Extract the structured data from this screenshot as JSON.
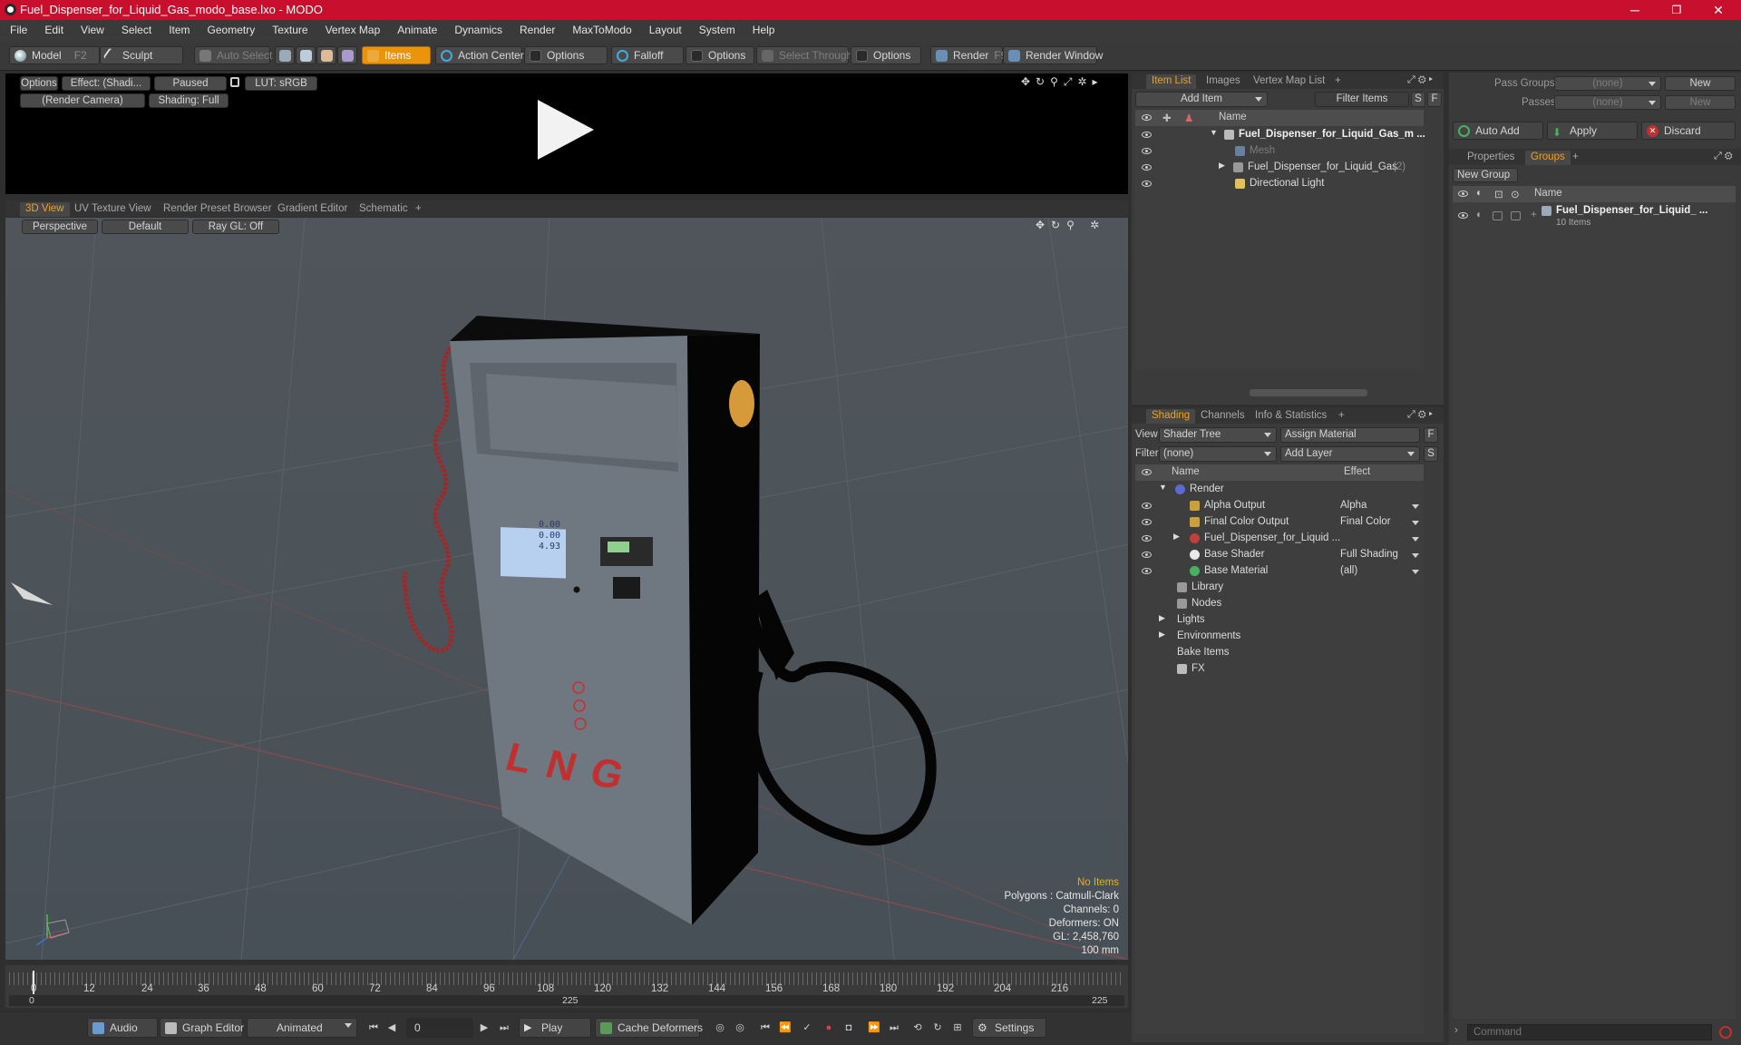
{
  "window": {
    "title": "Fuel_Dispenser_for_Liquid_Gas_modo_base.lxo - MODO",
    "minimize": "─",
    "maximize": "❐",
    "close": "✕"
  },
  "menu": [
    "File",
    "Edit",
    "View",
    "Select",
    "Item",
    "Geometry",
    "Texture",
    "Vertex Map",
    "Animate",
    "Dynamics",
    "Render",
    "MaxToModo",
    "Layout",
    "System",
    "Help"
  ],
  "toolbar": {
    "model": "Model",
    "model_key": "F2",
    "sculpt": "Sculpt",
    "auto_select": "Auto Select",
    "items": "Items",
    "action_center": "Action Center",
    "options1": "Options",
    "falloff": "Falloff",
    "options2": "Options",
    "select_through": "Select Through",
    "options3": "Options",
    "render": "Render",
    "render_key": "F9",
    "render_window": "Render Window"
  },
  "preview": {
    "options": "Options",
    "effect": "Effect: (Shadi...",
    "paused": "Paused",
    "lut": "LUT: sRGB",
    "camera": "(Render Camera)",
    "shading": "Shading: Full"
  },
  "view_tabs": [
    "3D View",
    "UV Texture View",
    "Render Preset Browser",
    "Gradient Editor",
    "Schematic",
    "+"
  ],
  "viewport": {
    "perspective": "Perspective",
    "default": "Default",
    "raygl": "Ray GL: Off",
    "lng_text": "LNG",
    "display_a": "0.00",
    "display_b": "0.00",
    "display_c": "4.93",
    "hud": {
      "no_items": "No Items",
      "polygons": "Polygons : Catmull-Clark",
      "channels": "Channels: 0",
      "deformers": "Deformers: ON",
      "gl": "GL: 2,458,760",
      "unit": "100 mm"
    }
  },
  "timeline": {
    "ticks": [
      "0",
      "12",
      "24",
      "36",
      "48",
      "60",
      "72",
      "84",
      "96",
      "108",
      "120",
      "132",
      "144",
      "156",
      "168",
      "180",
      "192",
      "204",
      "216"
    ],
    "start": "0",
    "mid": "225",
    "end": "225"
  },
  "bottombar": {
    "audio": "Audio",
    "graph_editor": "Graph Editor",
    "animated": "Animated",
    "frame": "0",
    "play": "Play",
    "cache_deformers": "Cache Deformers",
    "settings": "Settings",
    "command_placeholder": "Command"
  },
  "itemlist": {
    "tabs": [
      "Item List",
      "Images",
      "Vertex Map List",
      "+"
    ],
    "add_item": "Add Item",
    "filter_items": "Filter Items",
    "s": "S",
    "f": "F",
    "col_name": "Name",
    "rows": [
      {
        "label": "Fuel_Dispenser_for_Liquid_Gas_m ..."
      },
      {
        "label": "Mesh"
      },
      {
        "label": "Fuel_Dispenser_for_Liquid_Gas",
        "count": "(2)"
      },
      {
        "label": "Directional Light"
      }
    ]
  },
  "shading": {
    "tabs": [
      "Shading",
      "Channels",
      "Info & Statistics",
      "+"
    ],
    "view_label": "View",
    "view_value": "Shader Tree",
    "assign_material": "Assign Material",
    "filter_label": "Filter",
    "filter_value": "(none)",
    "add_layer": "Add Layer",
    "f": "F",
    "s": "S",
    "col_name": "Name",
    "col_effect": "Effect",
    "rows": [
      {
        "label": "Render",
        "effect": ""
      },
      {
        "label": "Alpha Output",
        "effect": "Alpha"
      },
      {
        "label": "Final Color Output",
        "effect": "Final Color"
      },
      {
        "label": "Fuel_Dispenser_for_Liquid ...",
        "effect": ""
      },
      {
        "label": "Base Shader",
        "effect": "Full Shading"
      },
      {
        "label": "Base Material",
        "effect": "(all)"
      },
      {
        "label": "Library",
        "effect": ""
      },
      {
        "label": "Nodes",
        "effect": ""
      },
      {
        "label": "Lights",
        "effect": ""
      },
      {
        "label": "Environments",
        "effect": ""
      },
      {
        "label": "Bake Items",
        "effect": ""
      },
      {
        "label": "FX",
        "effect": ""
      }
    ]
  },
  "passes": {
    "pass_groups_label": "Pass Groups",
    "pass_groups_value": "(none)",
    "new": "New",
    "passes_label": "Passes",
    "passes_value": "(none)",
    "new2": "New",
    "auto_add": "Auto Add",
    "apply": "Apply",
    "discard": "Discard",
    "tabs": [
      "Properties",
      "Groups",
      "+"
    ],
    "new_group": "New Group",
    "col_name": "Name",
    "group_name": "Fuel_Dispenser_for_Liquid_ ...",
    "group_count": "10 Items"
  },
  "colors": {
    "title_bar": "#c8102e",
    "accent": "#f0a020",
    "active_tool": "#e8950c"
  }
}
